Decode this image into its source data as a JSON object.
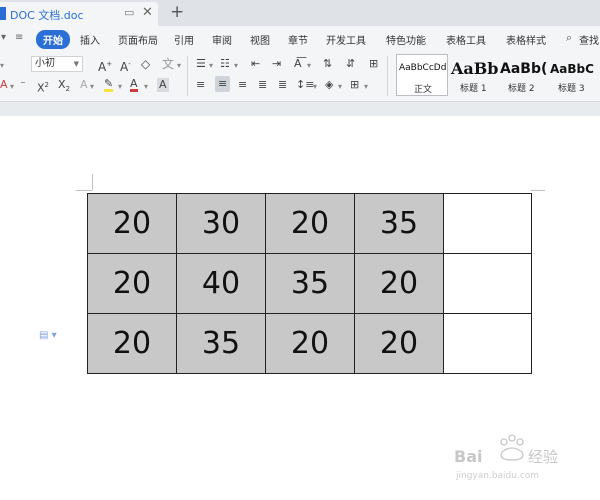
{
  "document_tab": {
    "title": "DOC 文档.doc",
    "icon": "word-doc-icon"
  },
  "menu": {
    "items": [
      "开始",
      "插入",
      "页面布局",
      "引用",
      "审阅",
      "视图",
      "章节",
      "开发工具",
      "特色功能",
      "表格工具",
      "表格样式"
    ],
    "active": "开始",
    "search_label": "查找"
  },
  "ribbon": {
    "font_size_value": "小初",
    "styles": [
      {
        "sample": "AaBbCcDd",
        "name": "正文"
      },
      {
        "sample": "AaBb",
        "name": "标题 1"
      },
      {
        "sample": "AaBb(",
        "name": "标题 2"
      },
      {
        "sample": "AaBbC",
        "name": "标题 3"
      }
    ]
  },
  "table": {
    "rows": [
      [
        "20",
        "30",
        "20",
        "35",
        ""
      ],
      [
        "20",
        "40",
        "35",
        "20",
        ""
      ],
      [
        "20",
        "35",
        "20",
        "20",
        ""
      ]
    ],
    "shaded_columns": 4,
    "shade_color": "#c8c8c8"
  },
  "watermark": {
    "text": "Baidu 经验",
    "url": "jingyan.baidu.com"
  },
  "colors": {
    "accent": "#2b6fd6",
    "toolbar_bg": "#f3f5f7",
    "tab_bar_bg": "#dfe3e8"
  }
}
